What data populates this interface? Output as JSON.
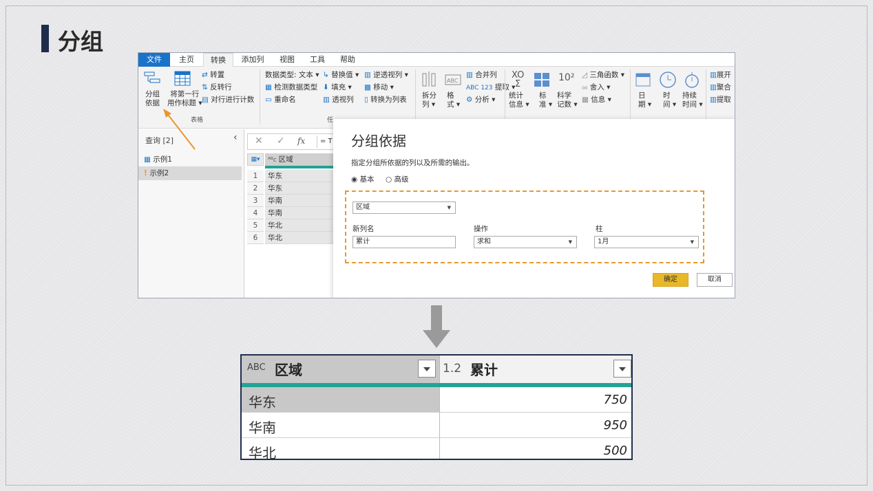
{
  "slide": {
    "title": "分组"
  },
  "ribbon": {
    "tabs": [
      "文件",
      "主页",
      "转换",
      "添加列",
      "视图",
      "工具",
      "帮助"
    ],
    "group_by": {
      "line1": "分组",
      "line2": "依据"
    },
    "use_first_row": {
      "line1": "将第一行",
      "line2": "用作标题 ▾"
    },
    "transpose": "转置",
    "reverse_rows": "反转行",
    "count_rows": "对行进行计数",
    "table_group_label": "表格",
    "data_type": "数据类型: 文本 ▾",
    "detect_type": "检测数据类型",
    "rename": "重命名",
    "replace_values": "替换值 ▾",
    "fill": "填充 ▾",
    "pivot": "透视列",
    "unpivot": "逆透视列 ▾",
    "move": "移动 ▾",
    "to_list": "转换为列表",
    "any_col_label": "任",
    "split": {
      "line1": "拆分",
      "line2": "列 ▾"
    },
    "format": {
      "line1": "格",
      "line2": "式 ▾"
    },
    "merge": "合并列",
    "extract": "提取 ▾",
    "parse": "分析 ▾",
    "stats": {
      "line1": "统计",
      "line2": "信息 ▾"
    },
    "standard": {
      "line1": "标",
      "line2": "准 ▾"
    },
    "sci": {
      "line1": "科学",
      "line2": "记数 ▾"
    },
    "trig": "三角函数 ▾",
    "round": "舍入 ▾",
    "info": "信息 ▾",
    "date": {
      "line1": "日",
      "line2": "期 ▾"
    },
    "time": {
      "line1": "时",
      "line2": "间 ▾"
    },
    "duration": {
      "line1": "持续",
      "line2": "时间 ▾"
    },
    "expand": "展开",
    "aggregate": "聚合",
    "extract2": "提取",
    "sigma_top": "XO",
    "ten_sq": "10²",
    "abc": "ABC",
    "abc123": "ABC 123"
  },
  "queries": {
    "header": "查询 [2]",
    "items": [
      "示例1",
      "示例2"
    ]
  },
  "formula_bar": {
    "fx": "fx",
    "prefix": "= T"
  },
  "grid": {
    "header": "区域",
    "rows": [
      {
        "n": "1",
        "v": "华东"
      },
      {
        "n": "2",
        "v": "华东"
      },
      {
        "n": "3",
        "v": "华南"
      },
      {
        "n": "4",
        "v": "华南"
      },
      {
        "n": "5",
        "v": "华北"
      },
      {
        "n": "6",
        "v": "华北"
      }
    ]
  },
  "dialog": {
    "title": "分组依据",
    "desc": "指定分组所依据的列以及所需的输出。",
    "basic": "基本",
    "advanced": "高级",
    "group_column": "区域",
    "new_col_label": "新列名",
    "new_col_value": "累计",
    "op_label": "操作",
    "op_value": "求和",
    "col_label": "柱",
    "col_value": "1月",
    "ok": "确定",
    "cancel": "取消"
  },
  "result": {
    "col1_type": "ABC",
    "col1": "区域",
    "col2_type": "1.2",
    "col2": "累计",
    "rows": [
      {
        "region": "华东",
        "total": "750"
      },
      {
        "region": "华南",
        "total": "950"
      },
      {
        "region": "华北",
        "total": "500"
      }
    ]
  },
  "colors": {
    "accent": "#1f2d4d",
    "teal": "#21a396",
    "orange": "#e8962e",
    "ok": "#e8b82a"
  }
}
